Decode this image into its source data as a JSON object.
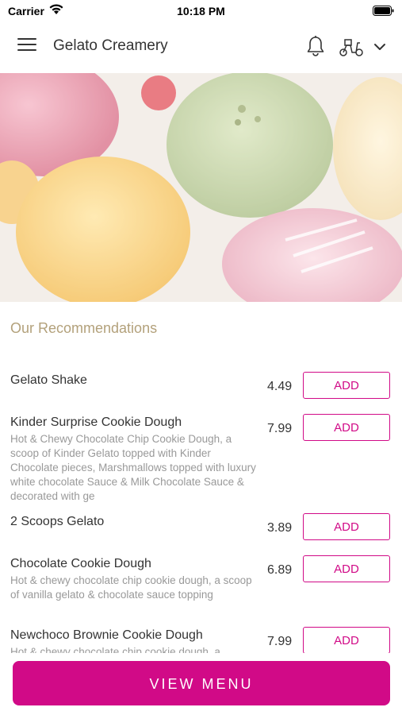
{
  "status_bar": {
    "carrier": "Carrier",
    "time": "10:18 PM"
  },
  "header": {
    "title": "Gelato Creamery",
    "menu_icon": "hamburger-menu-icon",
    "notification_icon": "bell-icon",
    "delivery_icon": "scooter-icon",
    "dropdown_icon": "chevron-down-icon"
  },
  "hero": {
    "image": "gelato-scoops-photo"
  },
  "recommendations": {
    "title": "Our Recommendations",
    "items": [
      {
        "name": "Gelato Shake",
        "description": "",
        "price": "4.49",
        "button": "ADD"
      },
      {
        "name": "Kinder Surprise Cookie Dough",
        "description": "Hot & Chewy Chocolate Chip Cookie Dough, a scoop of Kinder Gelato topped with Kinder Chocolate pieces, Marshmallows topped with luxury white chocolate Sauce & Milk Chocolate Sauce & decorated with ge",
        "price": "7.99",
        "button": "ADD"
      },
      {
        "name": "2 Scoops Gelato",
        "description": "",
        "price": "3.89",
        "button": "ADD"
      },
      {
        "name": "Chocolate Cookie Dough",
        "description": "Hot & chewy chocolate chip cookie dough, a scoop of vanilla gelato & chocolate sauce topping",
        "price": "6.89",
        "button": "ADD"
      },
      {
        "name": "Newchoco Brownie Cookie Dough",
        "description": "Hot & chewy chocolate chip cookie dough, a",
        "price": "7.99",
        "button": "ADD"
      }
    ]
  },
  "footer": {
    "view_menu": "VIEW MENU"
  },
  "colors": {
    "accent": "#d10a87",
    "section_title": "#b3a17b"
  }
}
